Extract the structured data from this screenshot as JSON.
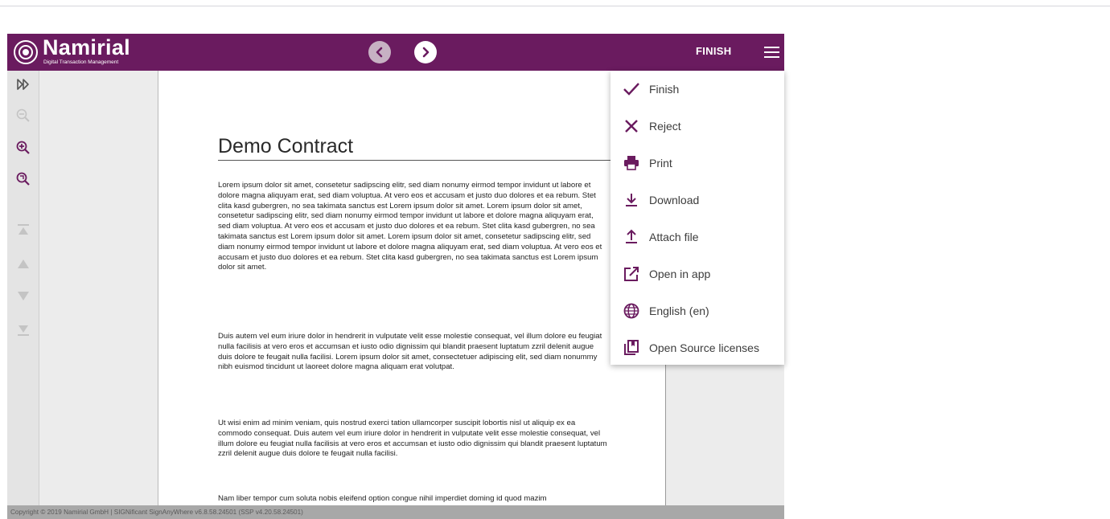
{
  "colors": {
    "brand": "#6a1b5f",
    "brand_light": "#c7b1c3",
    "toolbar_icon": "#6a1b5f",
    "disabled_icon": "#c0c0c0"
  },
  "header": {
    "logo_name": "Namirial",
    "logo_sub": "Digital Transaction Management",
    "finish_label": "FINISH",
    "icons": {
      "prev": "chevron-left-icon",
      "next": "chevron-right-icon",
      "menu": "hamburger-menu-icon"
    }
  },
  "toolbar": {
    "tools": [
      {
        "name": "expand-sidebar",
        "icon": "double-chevron-right-icon",
        "enabled": true
      },
      {
        "name": "zoom-out",
        "icon": "zoom-out-icon",
        "enabled": false
      },
      {
        "name": "zoom-in",
        "icon": "zoom-in-icon",
        "enabled": true
      },
      {
        "name": "zoom-reset",
        "icon": "zoom-reset-icon",
        "enabled": true
      },
      {
        "name": "first-page",
        "icon": "first-page-icon",
        "enabled": false
      },
      {
        "name": "previous-page",
        "icon": "triangle-up-icon",
        "enabled": false
      },
      {
        "name": "next-page",
        "icon": "triangle-down-icon",
        "enabled": false
      },
      {
        "name": "last-page",
        "icon": "last-page-icon",
        "enabled": false
      }
    ]
  },
  "document": {
    "title": "Demo Contract",
    "paragraphs": [
      "Lorem ipsum dolor sit amet, consetetur sadipscing elitr, sed diam nonumy eirmod tempor invidunt ut labore et dolore magna aliquyam erat, sed diam voluptua. At vero eos et accusam et justo duo dolores et ea rebum. Stet clita kasd gubergren, no sea takimata sanctus est Lorem ipsum dolor sit amet. Lorem ipsum dolor sit amet, consetetur sadipscing elitr, sed diam nonumy eirmod tempor invidunt ut labore et dolore magna aliquyam erat, sed diam voluptua. At vero eos et accusam et justo duo dolores et ea rebum. Stet clita kasd gubergren, no sea takimata sanctus est Lorem ipsum dolor sit amet. Lorem ipsum dolor sit amet, consetetur sadipscing elitr, sed diam nonumy eirmod tempor invidunt ut labore et dolore magna aliquyam erat, sed diam voluptua. At vero eos et accusam et justo duo dolores et ea rebum. Stet clita kasd gubergren, no sea takimata sanctus est Lorem ipsum dolor sit amet.",
      "Duis autem vel eum iriure dolor in hendrerit in vulputate velit esse molestie consequat, vel illum dolore eu feugiat nulla facilisis at vero eros et accumsan et iusto odio dignissim qui blandit praesent luptatum zzril delenit augue duis dolore te feugait nulla facilisi. Lorem ipsum dolor sit amet, consectetuer adipiscing elit, sed diam nonummy nibh euismod tincidunt ut laoreet dolore magna aliquam erat volutpat.",
      "Ut wisi enim ad minim veniam, quis nostrud exerci tation ullamcorper suscipit lobortis nisl ut aliquip ex ea commodo consequat. Duis autem vel eum iriure dolor in hendrerit in vulputate velit esse molestie consequat, vel illum dolore eu feugiat nulla facilisis at vero eros et accumsan et iusto odio dignissim qui blandit praesent luptatum zzril delenit augue duis dolore te feugait nulla facilisi.",
      "Nam liber tempor cum soluta nobis eleifend option congue nihil imperdiet doming id quod mazim"
    ]
  },
  "menu": {
    "items": [
      {
        "label": "Finish",
        "icon": "checkmark-icon"
      },
      {
        "label": "Reject",
        "icon": "close-icon"
      },
      {
        "label": "Print",
        "icon": "printer-icon"
      },
      {
        "label": "Download",
        "icon": "download-icon"
      },
      {
        "label": "Attach file",
        "icon": "upload-icon"
      },
      {
        "label": "Open in app",
        "icon": "open-external-icon"
      },
      {
        "label": "English (en)",
        "icon": "globe-icon"
      },
      {
        "label": "Open Source licenses",
        "icon": "licenses-icon"
      }
    ]
  },
  "footer": {
    "copyright": "Copyright © 2019 Namirial GmbH | SIGNificant SignAnyWhere v6.8.58.24501 (SSP v4.20.58.24501)"
  }
}
